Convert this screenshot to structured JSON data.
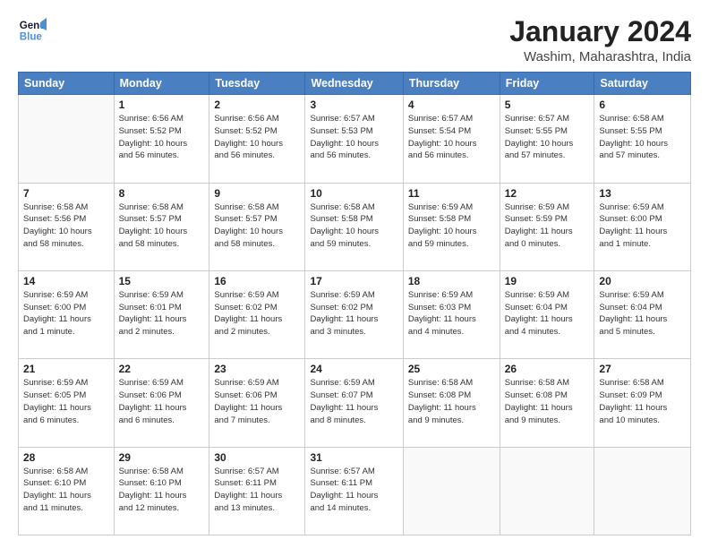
{
  "logo": {
    "line1": "General",
    "line2": "Blue"
  },
  "title": "January 2024",
  "location": "Washim, Maharashtra, India",
  "days_of_week": [
    "Sunday",
    "Monday",
    "Tuesday",
    "Wednesday",
    "Thursday",
    "Friday",
    "Saturday"
  ],
  "weeks": [
    [
      {
        "day": "",
        "info": ""
      },
      {
        "day": "1",
        "info": "Sunrise: 6:56 AM\nSunset: 5:52 PM\nDaylight: 10 hours\nand 56 minutes."
      },
      {
        "day": "2",
        "info": "Sunrise: 6:56 AM\nSunset: 5:52 PM\nDaylight: 10 hours\nand 56 minutes."
      },
      {
        "day": "3",
        "info": "Sunrise: 6:57 AM\nSunset: 5:53 PM\nDaylight: 10 hours\nand 56 minutes."
      },
      {
        "day": "4",
        "info": "Sunrise: 6:57 AM\nSunset: 5:54 PM\nDaylight: 10 hours\nand 56 minutes."
      },
      {
        "day": "5",
        "info": "Sunrise: 6:57 AM\nSunset: 5:55 PM\nDaylight: 10 hours\nand 57 minutes."
      },
      {
        "day": "6",
        "info": "Sunrise: 6:58 AM\nSunset: 5:55 PM\nDaylight: 10 hours\nand 57 minutes."
      }
    ],
    [
      {
        "day": "7",
        "info": "Sunrise: 6:58 AM\nSunset: 5:56 PM\nDaylight: 10 hours\nand 58 minutes."
      },
      {
        "day": "8",
        "info": "Sunrise: 6:58 AM\nSunset: 5:57 PM\nDaylight: 10 hours\nand 58 minutes."
      },
      {
        "day": "9",
        "info": "Sunrise: 6:58 AM\nSunset: 5:57 PM\nDaylight: 10 hours\nand 58 minutes."
      },
      {
        "day": "10",
        "info": "Sunrise: 6:58 AM\nSunset: 5:58 PM\nDaylight: 10 hours\nand 59 minutes."
      },
      {
        "day": "11",
        "info": "Sunrise: 6:59 AM\nSunset: 5:58 PM\nDaylight: 10 hours\nand 59 minutes."
      },
      {
        "day": "12",
        "info": "Sunrise: 6:59 AM\nSunset: 5:59 PM\nDaylight: 11 hours\nand 0 minutes."
      },
      {
        "day": "13",
        "info": "Sunrise: 6:59 AM\nSunset: 6:00 PM\nDaylight: 11 hours\nand 1 minute."
      }
    ],
    [
      {
        "day": "14",
        "info": "Sunrise: 6:59 AM\nSunset: 6:00 PM\nDaylight: 11 hours\nand 1 minute."
      },
      {
        "day": "15",
        "info": "Sunrise: 6:59 AM\nSunset: 6:01 PM\nDaylight: 11 hours\nand 2 minutes."
      },
      {
        "day": "16",
        "info": "Sunrise: 6:59 AM\nSunset: 6:02 PM\nDaylight: 11 hours\nand 2 minutes."
      },
      {
        "day": "17",
        "info": "Sunrise: 6:59 AM\nSunset: 6:02 PM\nDaylight: 11 hours\nand 3 minutes."
      },
      {
        "day": "18",
        "info": "Sunrise: 6:59 AM\nSunset: 6:03 PM\nDaylight: 11 hours\nand 4 minutes."
      },
      {
        "day": "19",
        "info": "Sunrise: 6:59 AM\nSunset: 6:04 PM\nDaylight: 11 hours\nand 4 minutes."
      },
      {
        "day": "20",
        "info": "Sunrise: 6:59 AM\nSunset: 6:04 PM\nDaylight: 11 hours\nand 5 minutes."
      }
    ],
    [
      {
        "day": "21",
        "info": "Sunrise: 6:59 AM\nSunset: 6:05 PM\nDaylight: 11 hours\nand 6 minutes."
      },
      {
        "day": "22",
        "info": "Sunrise: 6:59 AM\nSunset: 6:06 PM\nDaylight: 11 hours\nand 6 minutes."
      },
      {
        "day": "23",
        "info": "Sunrise: 6:59 AM\nSunset: 6:06 PM\nDaylight: 11 hours\nand 7 minutes."
      },
      {
        "day": "24",
        "info": "Sunrise: 6:59 AM\nSunset: 6:07 PM\nDaylight: 11 hours\nand 8 minutes."
      },
      {
        "day": "25",
        "info": "Sunrise: 6:58 AM\nSunset: 6:08 PM\nDaylight: 11 hours\nand 9 minutes."
      },
      {
        "day": "26",
        "info": "Sunrise: 6:58 AM\nSunset: 6:08 PM\nDaylight: 11 hours\nand 9 minutes."
      },
      {
        "day": "27",
        "info": "Sunrise: 6:58 AM\nSunset: 6:09 PM\nDaylight: 11 hours\nand 10 minutes."
      }
    ],
    [
      {
        "day": "28",
        "info": "Sunrise: 6:58 AM\nSunset: 6:10 PM\nDaylight: 11 hours\nand 11 minutes."
      },
      {
        "day": "29",
        "info": "Sunrise: 6:58 AM\nSunset: 6:10 PM\nDaylight: 11 hours\nand 12 minutes."
      },
      {
        "day": "30",
        "info": "Sunrise: 6:57 AM\nSunset: 6:11 PM\nDaylight: 11 hours\nand 13 minutes."
      },
      {
        "day": "31",
        "info": "Sunrise: 6:57 AM\nSunset: 6:11 PM\nDaylight: 11 hours\nand 14 minutes."
      },
      {
        "day": "",
        "info": ""
      },
      {
        "day": "",
        "info": ""
      },
      {
        "day": "",
        "info": ""
      }
    ]
  ]
}
